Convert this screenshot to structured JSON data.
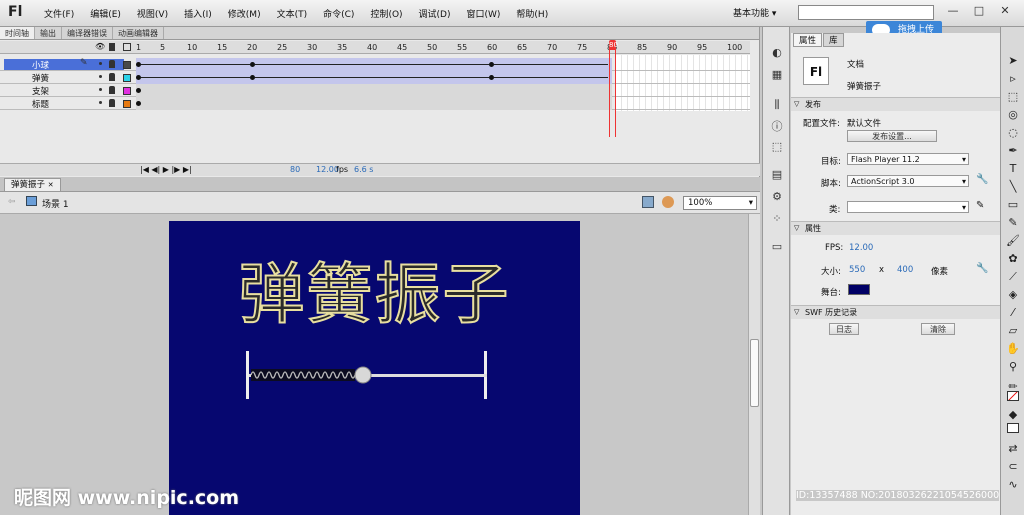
{
  "app": {
    "logo": "Fl",
    "menus": [
      "文件(F)",
      "编辑(E)",
      "视图(V)",
      "插入(I)",
      "修改(M)",
      "文本(T)",
      "命令(C)",
      "控制(O)",
      "调试(D)",
      "窗口(W)",
      "帮助(H)"
    ],
    "workspace": "基本功能 ▾",
    "search_placeholder": "",
    "upload_label": "拖拽上传",
    "win_min": "—",
    "win_max": "□",
    "win_close": "✕"
  },
  "timeline": {
    "tabs": [
      "时间轴",
      "输出",
      "编译器错误",
      "动画编辑器"
    ],
    "ticks": [
      "1",
      "5",
      "10",
      "15",
      "20",
      "25",
      "30",
      "35",
      "40",
      "45",
      "50",
      "55",
      "60",
      "65",
      "70",
      "75",
      "80",
      "85",
      "90",
      "95",
      "100"
    ],
    "layers": [
      {
        "name": "小球",
        "color": "#4a4a4a"
      },
      {
        "name": "弹簧",
        "color": "#2bd2e8"
      },
      {
        "name": "支架",
        "color": "#e030e0"
      },
      {
        "name": "标题",
        "color": "#e87a10"
      }
    ],
    "playhead": "80",
    "footer": {
      "frame": "80",
      "fps": "12.00",
      "fps_unit": "fps",
      "time": "6.6 s"
    }
  },
  "document": {
    "tab": "弹簧振子",
    "tab_close": "✕",
    "scene": "场景 1",
    "zoom": "100%"
  },
  "stage": {
    "title": "弹簧振子",
    "bg": "#060770"
  },
  "properties": {
    "tabs": [
      "属性",
      "库"
    ],
    "doc_type": "文档",
    "doc_name": "弹簧振子",
    "doc_icon": "Fl",
    "publish_header": "发布",
    "profile_label": "配置文件:",
    "profile_value": "默认文件",
    "publish_settings": "发布设置...",
    "target_label": "目标:",
    "target": "Flash Player 11.2",
    "script_label": "脚本:",
    "script": "ActionScript 3.0",
    "class_label": "类:",
    "props_header": "属性",
    "fps_label": "FPS:",
    "fps": "12.00",
    "size_label": "大小:",
    "width": "550",
    "x": "x",
    "height": "400",
    "unit": "像素",
    "stage_label": "舞台:",
    "stage_color": "#000066",
    "swf_header": "SWF 历史记录",
    "log_btn": "日志",
    "clear_btn": "清除"
  },
  "watermark": "昵图网 www.nipic.com",
  "id_text": "ID:13357488 NO:20180326221054526000"
}
